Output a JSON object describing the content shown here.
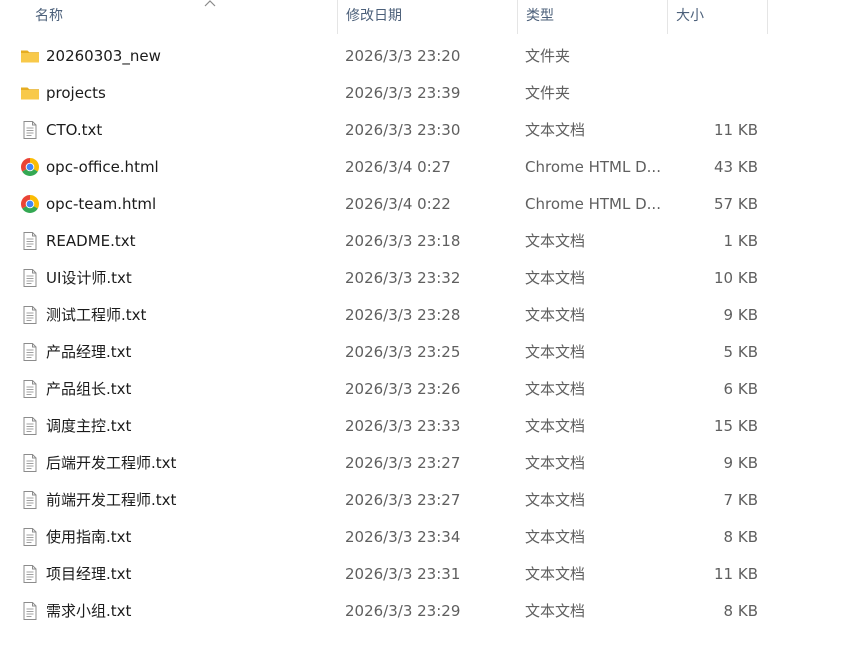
{
  "columns": {
    "name": "名称",
    "modified": "修改日期",
    "type": "类型",
    "size": "大小"
  },
  "files": [
    {
      "icon": "folder-icon",
      "name": "20260303_new",
      "modified": "2026/3/3 23:20",
      "type": "文件夹",
      "size": ""
    },
    {
      "icon": "folder-icon",
      "name": "projects",
      "modified": "2026/3/3 23:39",
      "type": "文件夹",
      "size": ""
    },
    {
      "icon": "text-file-icon",
      "name": "CTO.txt",
      "modified": "2026/3/3 23:30",
      "type": "文本文档",
      "size": "11 KB"
    },
    {
      "icon": "chrome-icon",
      "name": "opc-office.html",
      "modified": "2026/3/4 0:27",
      "type": "Chrome HTML D...",
      "size": "43 KB"
    },
    {
      "icon": "chrome-icon",
      "name": "opc-team.html",
      "modified": "2026/3/4 0:22",
      "type": "Chrome HTML D...",
      "size": "57 KB"
    },
    {
      "icon": "text-file-icon",
      "name": "README.txt",
      "modified": "2026/3/3 23:18",
      "type": "文本文档",
      "size": "1 KB"
    },
    {
      "icon": "text-file-icon",
      "name": "UI设计师.txt",
      "modified": "2026/3/3 23:32",
      "type": "文本文档",
      "size": "10 KB"
    },
    {
      "icon": "text-file-icon",
      "name": "测试工程师.txt",
      "modified": "2026/3/3 23:28",
      "type": "文本文档",
      "size": "9 KB"
    },
    {
      "icon": "text-file-icon",
      "name": "产品经理.txt",
      "modified": "2026/3/3 23:25",
      "type": "文本文档",
      "size": "5 KB"
    },
    {
      "icon": "text-file-icon",
      "name": "产品组长.txt",
      "modified": "2026/3/3 23:26",
      "type": "文本文档",
      "size": "6 KB"
    },
    {
      "icon": "text-file-icon",
      "name": "调度主控.txt",
      "modified": "2026/3/3 23:33",
      "type": "文本文档",
      "size": "15 KB"
    },
    {
      "icon": "text-file-icon",
      "name": "后端开发工程师.txt",
      "modified": "2026/3/3 23:27",
      "type": "文本文档",
      "size": "9 KB"
    },
    {
      "icon": "text-file-icon",
      "name": "前端开发工程师.txt",
      "modified": "2026/3/3 23:27",
      "type": "文本文档",
      "size": "7 KB"
    },
    {
      "icon": "text-file-icon",
      "name": "使用指南.txt",
      "modified": "2026/3/3 23:34",
      "type": "文本文档",
      "size": "8 KB"
    },
    {
      "icon": "text-file-icon",
      "name": "项目经理.txt",
      "modified": "2026/3/3 23:31",
      "type": "文本文档",
      "size": "11 KB"
    },
    {
      "icon": "text-file-icon",
      "name": "需求小组.txt",
      "modified": "2026/3/3 23:29",
      "type": "文本文档",
      "size": "8 KB"
    }
  ],
  "colors": {
    "header_text": "#4c607a",
    "folder": "#f8c94a",
    "folder_dark": "#e6ad22",
    "secondary_text": "#5f5f5f"
  }
}
